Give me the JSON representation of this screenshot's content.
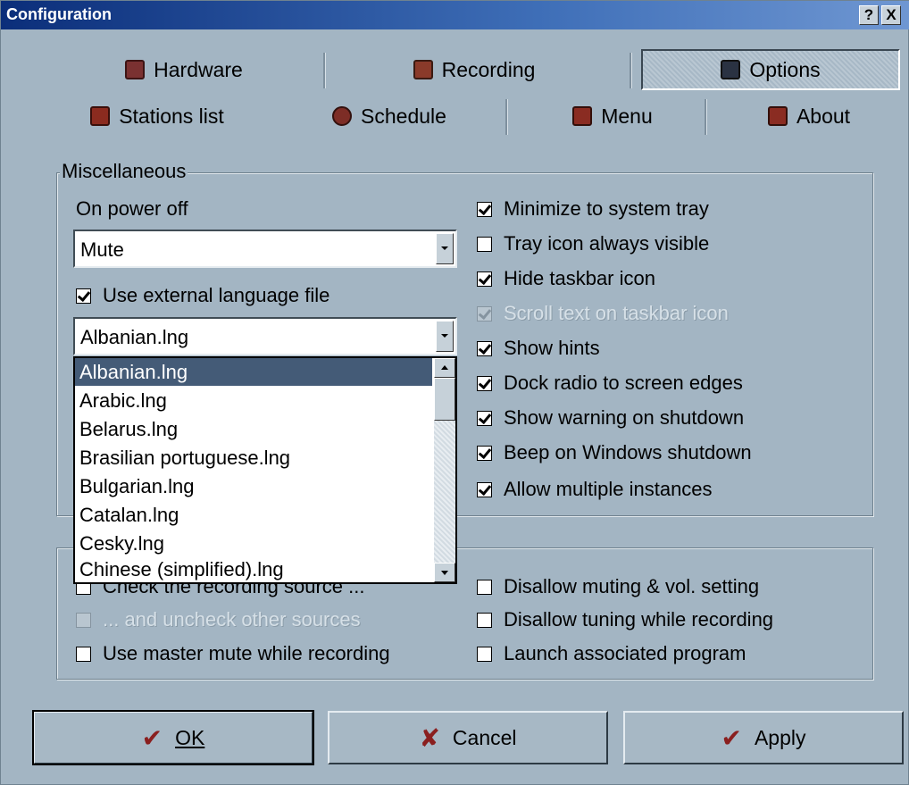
{
  "window": {
    "title": "Configuration",
    "help_glyph": "?",
    "close_glyph": "X"
  },
  "tabs_row1": [
    {
      "label": "Hardware",
      "icon": "hardware-icon",
      "active": false
    },
    {
      "label": "Recording",
      "icon": "recording-icon",
      "active": false
    },
    {
      "label": "Options",
      "icon": "options-icon",
      "active": true
    }
  ],
  "tabs_row2": [
    {
      "label": "Stations list",
      "icon": "stations-list-icon"
    },
    {
      "label": "Schedule",
      "icon": "schedule-icon"
    },
    {
      "label": "Menu",
      "icon": "menu-icon"
    },
    {
      "label": "About",
      "icon": "about-icon"
    }
  ],
  "misc": {
    "legend": "Miscellaneous",
    "power_off_label": "On power off",
    "power_off_value": "Mute",
    "use_lang_label": "Use external language file",
    "use_lang_checked": true,
    "lang_value": "Albanian.lng",
    "lang_options": [
      "Albanian.lng",
      "Arabic.lng",
      "Belarus.lng",
      "Brasilian portuguese.lng",
      "Bulgarian.lng",
      "Catalan.lng",
      "Cesky.lng",
      "Chinese (simplified).lng"
    ],
    "right_options": [
      {
        "label": "Minimize to system tray",
        "checked": true,
        "disabled": false
      },
      {
        "label": "Tray icon always visible",
        "checked": false,
        "disabled": false
      },
      {
        "label": "Hide taskbar icon",
        "checked": true,
        "disabled": false
      },
      {
        "label": "Scroll text on taskbar icon",
        "checked": true,
        "disabled": true
      },
      {
        "label": "Show hints",
        "checked": true,
        "disabled": false
      },
      {
        "label": "Dock radio to screen edges",
        "checked": true,
        "disabled": false
      },
      {
        "label": "Show warning on shutdown",
        "checked": true,
        "disabled": false
      },
      {
        "label": "Beep on Windows shutdown",
        "checked": true,
        "disabled": false
      },
      {
        "label": "Allow multiple instances",
        "checked": true,
        "disabled": false
      }
    ]
  },
  "recording": {
    "left_options": [
      {
        "label": "Check the recording source ...",
        "checked": false,
        "disabled": false
      },
      {
        "label": "... and uncheck other sources",
        "checked": false,
        "disabled": true
      },
      {
        "label": "Use master mute while recording",
        "checked": false,
        "disabled": false
      }
    ],
    "right_options": [
      {
        "label": "Disallow muting & vol. setting",
        "checked": false,
        "disabled": false
      },
      {
        "label": "Disallow tuning while recording",
        "checked": false,
        "disabled": false
      },
      {
        "label": "Launch associated program",
        "checked": false,
        "disabled": false
      }
    ]
  },
  "buttons": {
    "ok": "OK",
    "cancel": "Cancel",
    "apply": "Apply"
  },
  "colors": {
    "window_bg": "#a3b5c3",
    "title_start": "#0b2e7a",
    "selection": "#445b77"
  }
}
